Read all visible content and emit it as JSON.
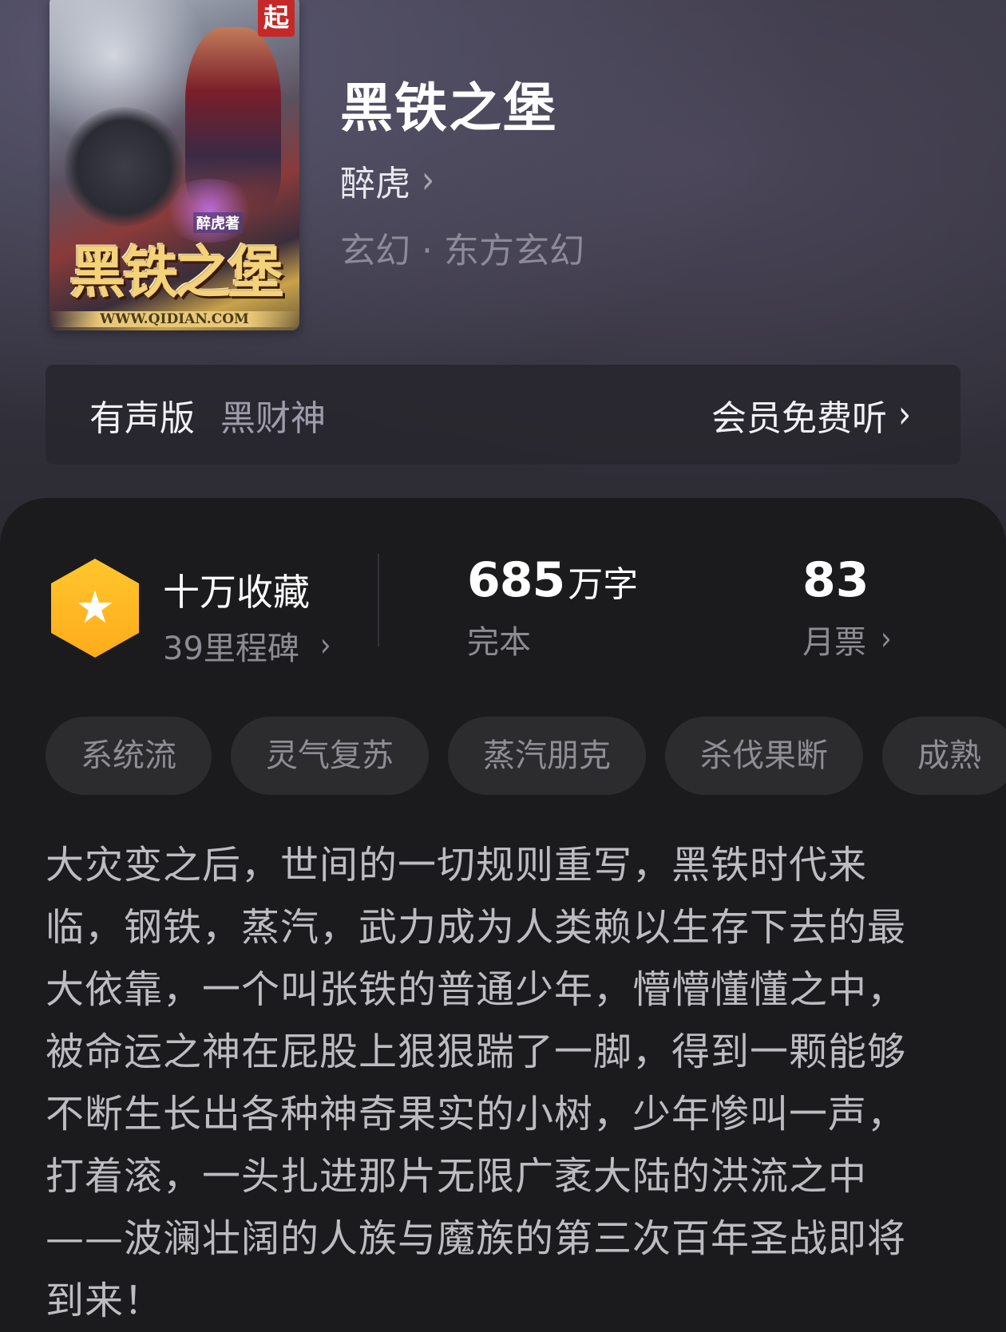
{
  "book": {
    "title": "黑铁之堡",
    "author": "醉虎",
    "genre_main": "玄幻",
    "genre_sep": "·",
    "genre_sub": "东方玄幻"
  },
  "cover": {
    "badge": "起",
    "title_art": "黑铁之堡",
    "sub_art": "醉虎著",
    "url_art": "WWW.QIDIAN.COM"
  },
  "audio": {
    "label": "有声版",
    "narrator": "黑财神",
    "cta": "会员免费听"
  },
  "stats": {
    "favorites_main": "十万收藏",
    "favorites_sub": "39里程碑",
    "words_number": "685",
    "words_unit": "万字",
    "status": "完本",
    "tickets_number": "83",
    "tickets_label": "月票"
  },
  "tags": [
    "系统流",
    "灵气复苏",
    "蒸汽朋克",
    "杀伐果断",
    "成熟"
  ],
  "description": "大灾变之后，世间的一切规则重写，黑铁时代来临，钢铁，蒸汽，武力成为人类赖以生存下去的最大依靠，一个叫张铁的普通少年，懵懵懂懂之中，被命运之神在屁股上狠狠踹了一脚，得到一颗能够不断生长出各种神奇果实的小树，少年惨叫一声，打着滚，一头扎进那片无限广袤大陆的洪流之中——波澜壮阔的人族与魔族的第三次百年圣战即将到来！",
  "icons": {
    "chevron": "chevron-right-icon",
    "star": "star-icon"
  },
  "colors": {
    "accent_gold": "#ffb81f",
    "background": "#1b1b1d",
    "tag_bg": "#2c2c2f"
  }
}
